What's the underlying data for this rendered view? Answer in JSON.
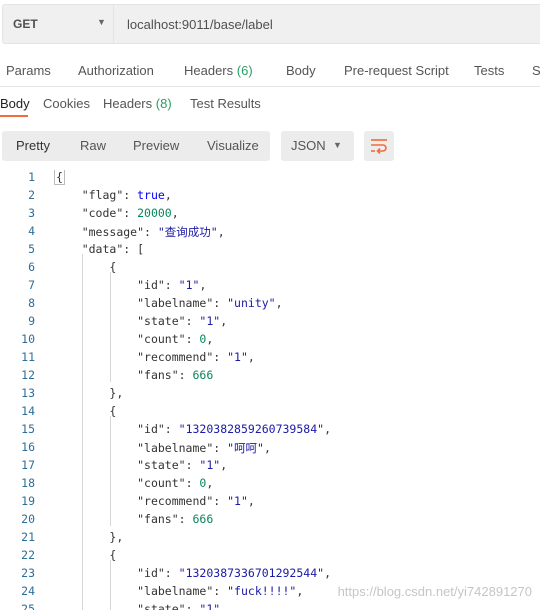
{
  "request": {
    "method": "GET",
    "url": "localhost:9011/base/label"
  },
  "request_tabs": [
    {
      "label": "Params"
    },
    {
      "label": "Authorization"
    },
    {
      "label": "Headers",
      "count": "(6)"
    },
    {
      "label": "Body"
    },
    {
      "label": "Pre-request Script"
    },
    {
      "label": "Tests"
    },
    {
      "label": "S"
    }
  ],
  "response_tabs": [
    {
      "label": "Body"
    },
    {
      "label": "Cookies"
    },
    {
      "label": "Headers",
      "count": "(8)"
    },
    {
      "label": "Test Results"
    }
  ],
  "toolbar": {
    "formats": [
      "Pretty",
      "Raw",
      "Preview",
      "Visualize"
    ],
    "language": "JSON",
    "wrap_icon": "wrap-lines-icon"
  },
  "code_lines": [
    {
      "n": "1",
      "t": [
        [
          "b",
          "{"
        ]
      ]
    },
    {
      "n": "2",
      "t": [
        [
          "i",
          "    "
        ],
        [
          "k",
          "\"flag\""
        ],
        [
          "p",
          ": "
        ],
        [
          "w",
          "true"
        ],
        [
          "p",
          ","
        ]
      ]
    },
    {
      "n": "3",
      "t": [
        [
          "i",
          "    "
        ],
        [
          "k",
          "\"code\""
        ],
        [
          "p",
          ": "
        ],
        [
          "d",
          "20000"
        ],
        [
          "p",
          ","
        ]
      ]
    },
    {
      "n": "4",
      "t": [
        [
          "i",
          "    "
        ],
        [
          "k",
          "\"message\""
        ],
        [
          "p",
          ": "
        ],
        [
          "s",
          "\"查询成功\""
        ],
        [
          "p",
          ","
        ]
      ]
    },
    {
      "n": "5",
      "t": [
        [
          "i",
          "    "
        ],
        [
          "k",
          "\"data\""
        ],
        [
          "p",
          ": ["
        ]
      ]
    },
    {
      "n": "6",
      "t": [
        [
          "i",
          "        "
        ],
        [
          "p",
          "{"
        ]
      ]
    },
    {
      "n": "7",
      "t": [
        [
          "i",
          "            "
        ],
        [
          "k",
          "\"id\""
        ],
        [
          "p",
          ": "
        ],
        [
          "s",
          "\"1\""
        ],
        [
          "p",
          ","
        ]
      ]
    },
    {
      "n": "8",
      "t": [
        [
          "i",
          "            "
        ],
        [
          "k",
          "\"labelname\""
        ],
        [
          "p",
          ": "
        ],
        [
          "s",
          "\"unity\""
        ],
        [
          "p",
          ","
        ]
      ]
    },
    {
      "n": "9",
      "t": [
        [
          "i",
          "            "
        ],
        [
          "k",
          "\"state\""
        ],
        [
          "p",
          ": "
        ],
        [
          "s",
          "\"1\""
        ],
        [
          "p",
          ","
        ]
      ]
    },
    {
      "n": "10",
      "t": [
        [
          "i",
          "            "
        ],
        [
          "k",
          "\"count\""
        ],
        [
          "p",
          ": "
        ],
        [
          "d",
          "0"
        ],
        [
          "p",
          ","
        ]
      ]
    },
    {
      "n": "11",
      "t": [
        [
          "i",
          "            "
        ],
        [
          "k",
          "\"recommend\""
        ],
        [
          "p",
          ": "
        ],
        [
          "s",
          "\"1\""
        ],
        [
          "p",
          ","
        ]
      ]
    },
    {
      "n": "12",
      "t": [
        [
          "i",
          "            "
        ],
        [
          "k",
          "\"fans\""
        ],
        [
          "p",
          ": "
        ],
        [
          "d",
          "666"
        ]
      ]
    },
    {
      "n": "13",
      "t": [
        [
          "i",
          "        "
        ],
        [
          "p",
          "},"
        ]
      ]
    },
    {
      "n": "14",
      "t": [
        [
          "i",
          "        "
        ],
        [
          "p",
          "{"
        ]
      ]
    },
    {
      "n": "15",
      "t": [
        [
          "i",
          "            "
        ],
        [
          "k",
          "\"id\""
        ],
        [
          "p",
          ": "
        ],
        [
          "s",
          "\"1320382859260739584\""
        ],
        [
          "p",
          ","
        ]
      ]
    },
    {
      "n": "16",
      "t": [
        [
          "i",
          "            "
        ],
        [
          "k",
          "\"labelname\""
        ],
        [
          "p",
          ": "
        ],
        [
          "s",
          "\"呵呵\""
        ],
        [
          "p",
          ","
        ]
      ]
    },
    {
      "n": "17",
      "t": [
        [
          "i",
          "            "
        ],
        [
          "k",
          "\"state\""
        ],
        [
          "p",
          ": "
        ],
        [
          "s",
          "\"1\""
        ],
        [
          "p",
          ","
        ]
      ]
    },
    {
      "n": "18",
      "t": [
        [
          "i",
          "            "
        ],
        [
          "k",
          "\"count\""
        ],
        [
          "p",
          ": "
        ],
        [
          "d",
          "0"
        ],
        [
          "p",
          ","
        ]
      ]
    },
    {
      "n": "19",
      "t": [
        [
          "i",
          "            "
        ],
        [
          "k",
          "\"recommend\""
        ],
        [
          "p",
          ": "
        ],
        [
          "s",
          "\"1\""
        ],
        [
          "p",
          ","
        ]
      ]
    },
    {
      "n": "20",
      "t": [
        [
          "i",
          "            "
        ],
        [
          "k",
          "\"fans\""
        ],
        [
          "p",
          ": "
        ],
        [
          "d",
          "666"
        ]
      ]
    },
    {
      "n": "21",
      "t": [
        [
          "i",
          "        "
        ],
        [
          "p",
          "},"
        ]
      ]
    },
    {
      "n": "22",
      "t": [
        [
          "i",
          "        "
        ],
        [
          "p",
          "{"
        ]
      ]
    },
    {
      "n": "23",
      "t": [
        [
          "i",
          "            "
        ],
        [
          "k",
          "\"id\""
        ],
        [
          "p",
          ": "
        ],
        [
          "s",
          "\"1320387336701292544\""
        ],
        [
          "p",
          ","
        ]
      ]
    },
    {
      "n": "24",
      "t": [
        [
          "i",
          "            "
        ],
        [
          "k",
          "\"labelname\""
        ],
        [
          "p",
          ": "
        ],
        [
          "s",
          "\"fuck!!!!\""
        ],
        [
          "p",
          ","
        ]
      ]
    },
    {
      "n": "25",
      "t": [
        [
          "i",
          "            "
        ],
        [
          "k",
          "\"state\""
        ],
        [
          "p",
          ": "
        ],
        [
          "s",
          "\"1\""
        ],
        [
          "p",
          ","
        ]
      ]
    }
  ],
  "watermark": "https://blog.csdn.net/yi742891270"
}
